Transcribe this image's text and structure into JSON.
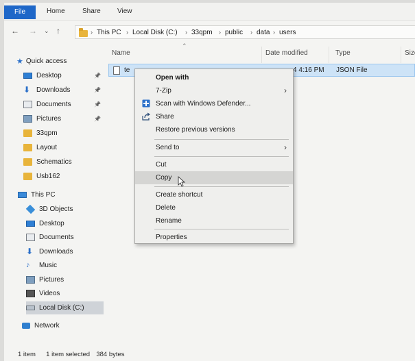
{
  "ribbon": {
    "tabs": [
      "File",
      "Home",
      "Share",
      "View"
    ]
  },
  "address": {
    "crumbs": [
      "This PC",
      "Local Disk (C:)",
      "33qpm",
      "public",
      "data",
      "users"
    ]
  },
  "columns": {
    "name": "Name",
    "date_modified": "Date modified",
    "type": "Type",
    "size": "Size"
  },
  "file": {
    "name_visible": "te",
    "date_visible": "4 4:16 PM",
    "type": "JSON File"
  },
  "sidebar": {
    "quick_access": "Quick access",
    "quick_items": [
      {
        "label": "Desktop",
        "icon": "desktop-icon",
        "pinned": true
      },
      {
        "label": "Downloads",
        "icon": "download-icon",
        "pinned": true
      },
      {
        "label": "Documents",
        "icon": "documents-icon",
        "pinned": true
      },
      {
        "label": "Pictures",
        "icon": "pictures-icon",
        "pinned": true
      },
      {
        "label": "33qpm",
        "icon": "folder-icon",
        "pinned": false
      },
      {
        "label": "Layout",
        "icon": "folder-icon",
        "pinned": false
      },
      {
        "label": "Schematics",
        "icon": "folder-icon",
        "pinned": false
      },
      {
        "label": "Usb162",
        "icon": "folder-icon",
        "pinned": false
      }
    ],
    "this_pc": "This PC",
    "pc_items": [
      {
        "label": "3D Objects",
        "icon": "3d-objects-icon"
      },
      {
        "label": "Desktop",
        "icon": "desktop-icon"
      },
      {
        "label": "Documents",
        "icon": "documents-icon"
      },
      {
        "label": "Downloads",
        "icon": "download-icon"
      },
      {
        "label": "Music",
        "icon": "music-icon"
      },
      {
        "label": "Pictures",
        "icon": "pictures-icon"
      },
      {
        "label": "Videos",
        "icon": "videos-icon"
      },
      {
        "label": "Local Disk (C:)",
        "icon": "drive-icon"
      }
    ],
    "network": "Network"
  },
  "context_menu": {
    "items": [
      {
        "label": "Open with",
        "bold": true
      },
      {
        "label": "7-Zip",
        "submenu": true
      },
      {
        "label": "Scan with Windows Defender...",
        "icon": "defender-icon"
      },
      {
        "label": "Share",
        "icon": "share-icon"
      },
      {
        "label": "Restore previous versions"
      },
      {
        "label": "Send to",
        "submenu": true
      },
      {
        "label": "Cut"
      },
      {
        "label": "Copy",
        "hovered": true
      },
      {
        "label": "Create shortcut"
      },
      {
        "label": "Delete"
      },
      {
        "label": "Rename"
      },
      {
        "label": "Properties"
      }
    ]
  },
  "status": {
    "count": "1 item",
    "selected": "1 item selected",
    "size": "384 bytes"
  },
  "colors": {
    "accent": "#1e67c8",
    "selection": "#cde3f7",
    "folder": "#e8b43b"
  }
}
